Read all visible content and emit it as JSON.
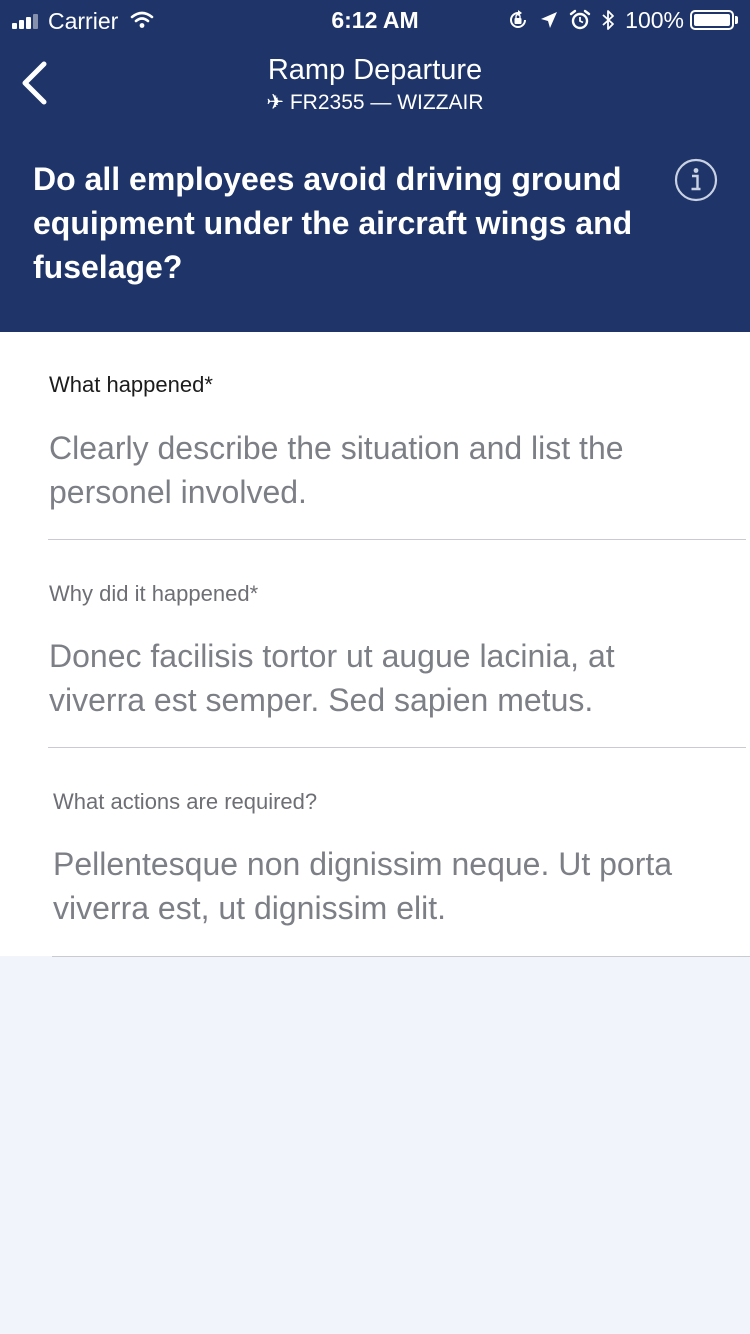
{
  "status_bar": {
    "carrier": "Carrier",
    "time": "6:12 AM",
    "battery": "100%",
    "battery_level": 1.0
  },
  "nav": {
    "title": "Ramp Departure",
    "subtitle": "✈ FR2355 — WIZZAIR",
    "back_icon": "chevron-left-icon"
  },
  "question": {
    "text": "Do all employees avoid driving ground equipment under the aircraft wings and fuselage?",
    "info_icon": "info-icon"
  },
  "form": {
    "fields": [
      {
        "label": "What happened*",
        "value": "Clearly describe the situation and list the personel involved."
      },
      {
        "label": "Why did it happened*",
        "value": "Donec facilisis tortor ut augue lacinia, at viverra est semper. Sed sapien metus."
      },
      {
        "label": "What actions are required?",
        "value": "Pellentesque non dignissim neque. Ut porta viverra est, ut dignissim elit."
      }
    ]
  },
  "colors": {
    "header_bg": "#1f3569",
    "page_bg": "#f1f4fa",
    "placeholder_text": "#7d7f86",
    "divider": "#c9cbd0"
  }
}
